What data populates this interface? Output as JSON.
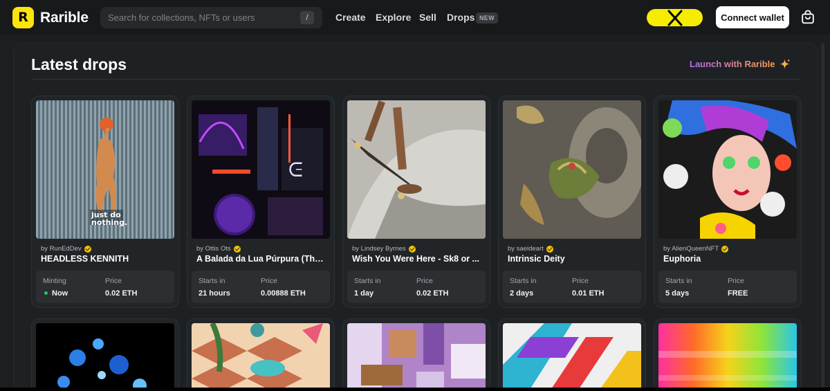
{
  "header": {
    "logo_text": "Rarible",
    "logo_mark": "R",
    "search_placeholder": "Search for collections, NFTs or users",
    "search_shortcut": "/",
    "nav": [
      "Create",
      "Explore",
      "Sell",
      "Drops"
    ],
    "drops_badge": "NEW",
    "connect_label": "Connect wallet",
    "x_pill_icon": "x-logo-icon",
    "bag_icon": "shopping-bag-icon"
  },
  "section": {
    "title": "Latest drops",
    "launch_label": "Launch with Rarible",
    "launch_icon": "sparkle-icon"
  },
  "drops": [
    {
      "creator": "by RunEdDev",
      "title": "HEADLESS KENNITH",
      "status_label": "Minting",
      "status_value": "Now",
      "price_label": "Price",
      "price": "0.02 ETH",
      "thumb_text": "just do nothing."
    },
    {
      "creator": "by Ottis Ots",
      "title": "A Balada da Lua Púrpura (The ...",
      "status_label": "Starts in",
      "status_value": "21 hours",
      "price_label": "Price",
      "price": "0.00888 ETH"
    },
    {
      "creator": "by Lindsey Byrnes",
      "title": "Wish You Were Here - Sk8 or ...",
      "status_label": "Starts in",
      "status_value": "1 day",
      "price_label": "Price",
      "price": "0.02 ETH"
    },
    {
      "creator": "by saeideart",
      "title": "Intrinsic Deity",
      "status_label": "Starts in",
      "status_value": "2 days",
      "price_label": "Price",
      "price": "0.01 ETH"
    },
    {
      "creator": "by AlienQueenNFT",
      "title": "Euphoria",
      "status_label": "Starts in",
      "status_value": "5 days",
      "price_label": "Price",
      "price": "FREE"
    }
  ],
  "colors": {
    "brand_yellow": "#fde50c",
    "background": "#1c1f22",
    "verified": "#f4c400",
    "live_dot": "#22c55e"
  }
}
